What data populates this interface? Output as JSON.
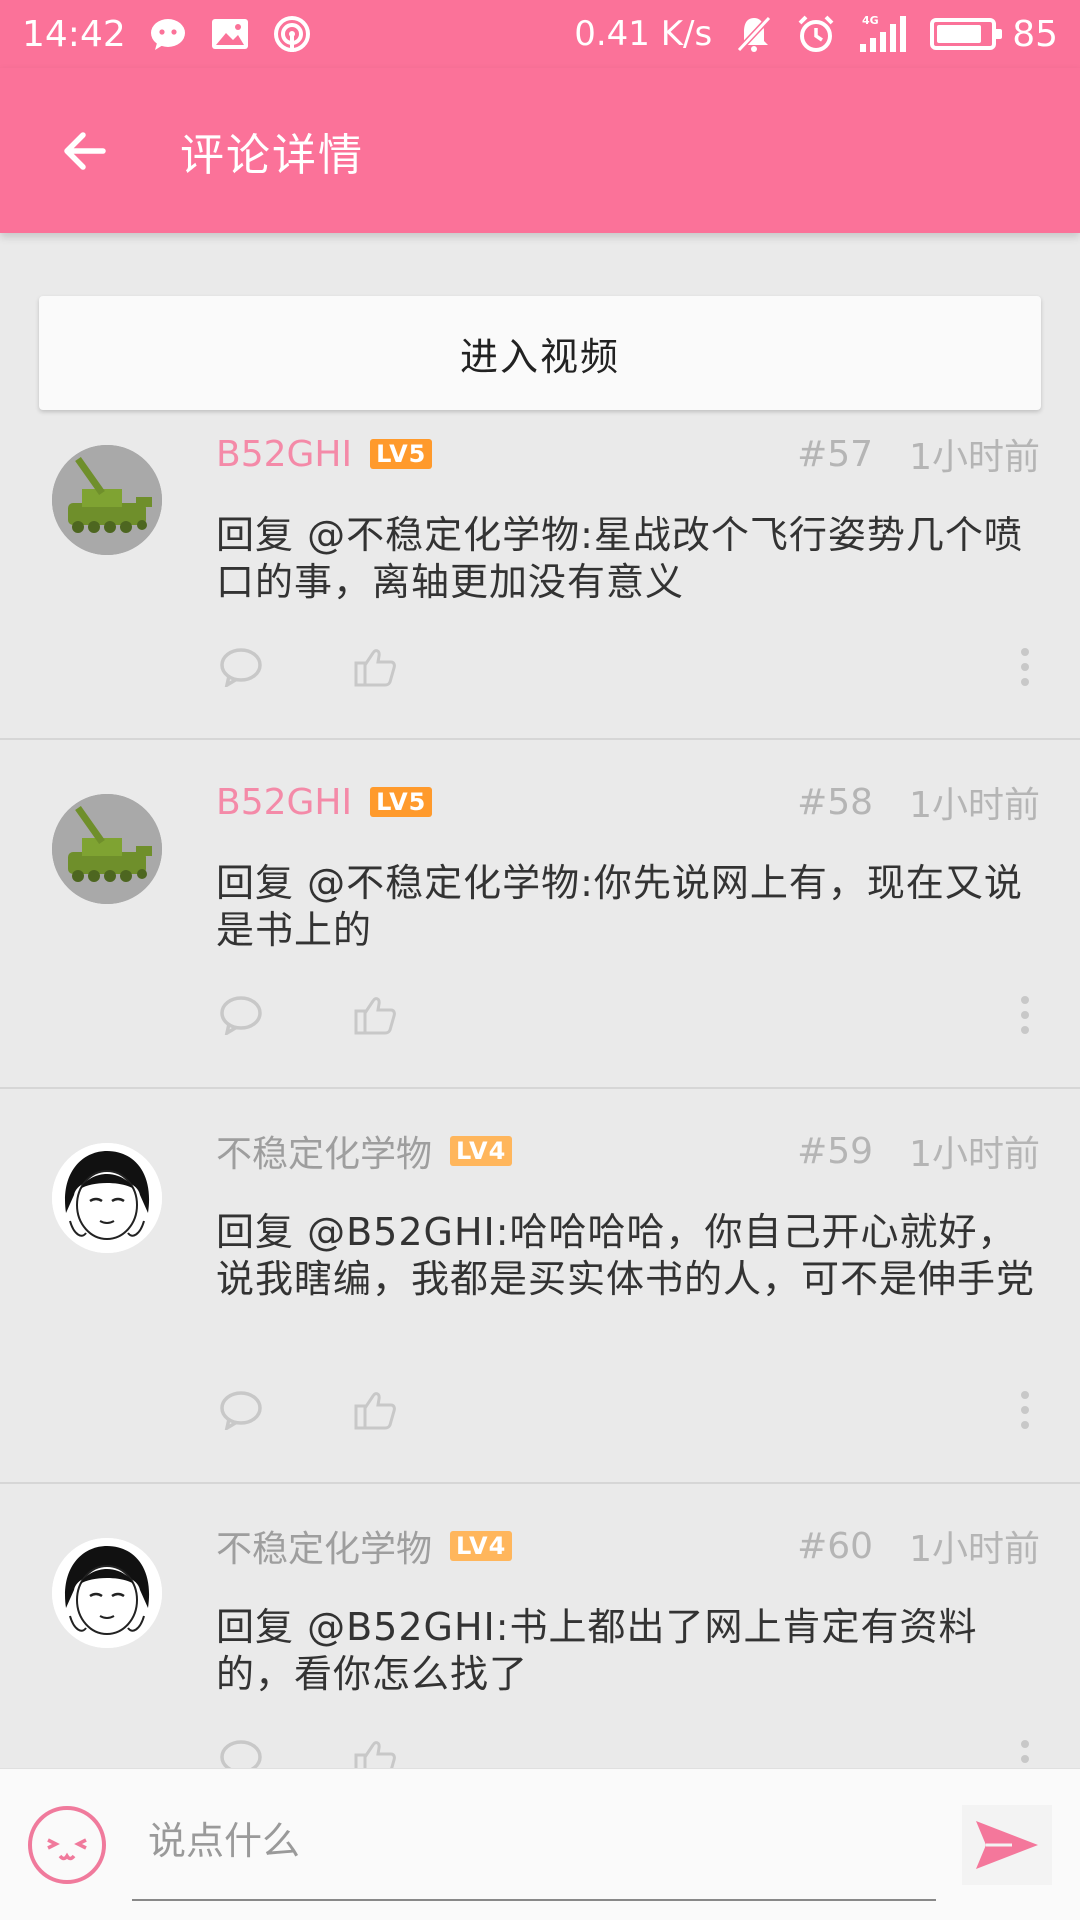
{
  "status_bar": {
    "time": "14:42",
    "net_speed": "0.41 K/s",
    "network": "4G",
    "battery": "85",
    "battery_level": 0.85,
    "icons": [
      "wechat-icon",
      "image-notification-icon",
      "hotspot-icon",
      "mute-icon",
      "alarm-icon",
      "signal-icon",
      "battery-icon"
    ]
  },
  "app_bar": {
    "title": "评论详情"
  },
  "enter_video_label": "进入视频",
  "colors": {
    "accent": "#fb7299",
    "name_pink": "#f48aa8",
    "lv5": "#ff9a2c",
    "lv4": "#ffb65c"
  },
  "comments": [
    {
      "user": "B52GHI",
      "level": "LV5",
      "floor": "#57",
      "time": "1小时前",
      "text": "回复 @不稳定化学物:星战改个飞行姿势几个喷口的事，离轴更加没有意义"
    },
    {
      "user": "B52GHI",
      "level": "LV5",
      "floor": "#58",
      "time": "1小时前",
      "text": "回复 @不稳定化学物:你先说网上有，现在又说是书上的"
    },
    {
      "user": "不稳定化学物",
      "level": "LV4",
      "floor": "#59",
      "time": "1小时前",
      "text": "回复 @B52GHI:哈哈哈哈，你自己开心就好，说我瞎编，我都是买实体书的人，可不是伸手党"
    },
    {
      "user": "不稳定化学物",
      "level": "LV4",
      "floor": "#60",
      "time": "1小时前",
      "text": "回复 @B52GHI:书上都出了网上肯定有资料的，看你怎么找了"
    }
  ],
  "input": {
    "placeholder": "说点什么"
  }
}
